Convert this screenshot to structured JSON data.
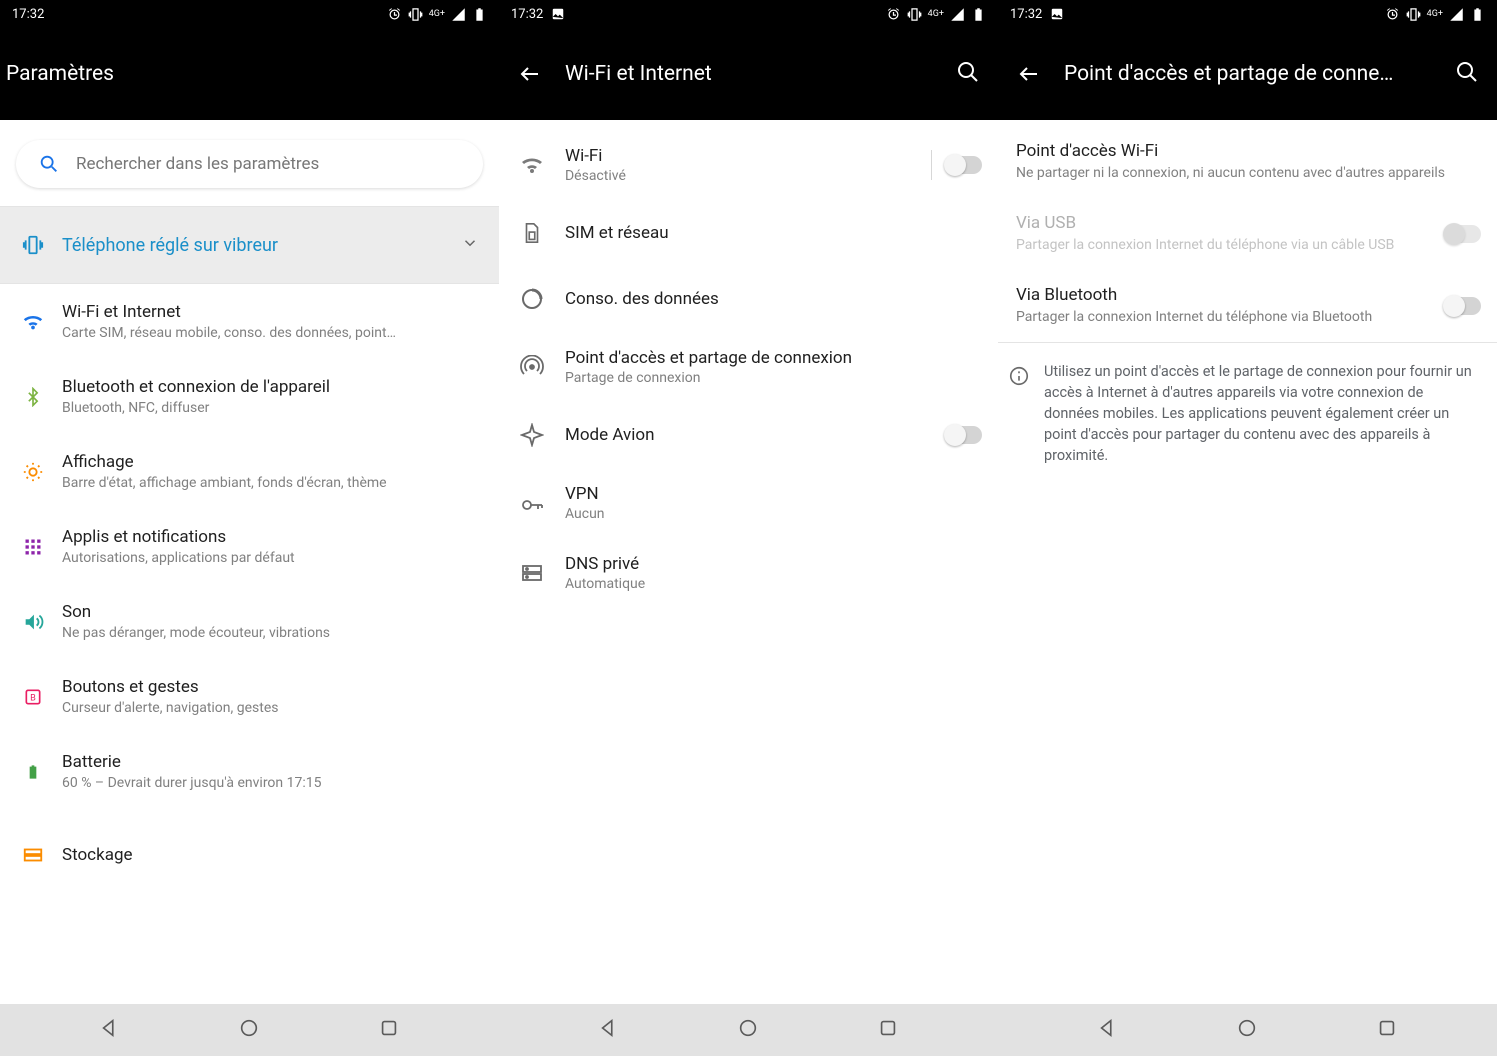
{
  "statusbar": {
    "time": "17:32"
  },
  "screen1": {
    "title": "Paramètres",
    "search_placeholder": "Rechercher dans les paramètres",
    "ringer_text": "Téléphone réglé sur vibreur",
    "items": [
      {
        "label": "Wi-Fi et Internet",
        "sub": "Carte SIM, réseau mobile, conso. des données, point…"
      },
      {
        "label": "Bluetooth et connexion de l'appareil",
        "sub": "Bluetooth, NFC, diffuser"
      },
      {
        "label": "Affichage",
        "sub": "Barre d'état, affichage ambiant, fonds d'écran, thème"
      },
      {
        "label": "Applis et notifications",
        "sub": "Autorisations, applications par défaut"
      },
      {
        "label": "Son",
        "sub": "Ne pas déranger, mode écouteur, vibrations"
      },
      {
        "label": "Boutons et gestes",
        "sub": "Curseur d'alerte, navigation, gestes"
      },
      {
        "label": "Batterie",
        "sub": "60 % – Devrait durer jusqu'à environ 17:15"
      },
      {
        "label": "Stockage",
        "sub": ""
      }
    ]
  },
  "screen2": {
    "title": "Wi-Fi et Internet",
    "items": [
      {
        "label": "Wi-Fi",
        "sub": "Désactivé"
      },
      {
        "label": "SIM et réseau",
        "sub": ""
      },
      {
        "label": "Conso. des données",
        "sub": ""
      },
      {
        "label": "Point d'accès et partage de connexion",
        "sub": "Partage de connexion"
      },
      {
        "label": "Mode Avion",
        "sub": ""
      },
      {
        "label": "VPN",
        "sub": "Aucun"
      },
      {
        "label": "DNS privé",
        "sub": "Automatique"
      }
    ]
  },
  "screen3": {
    "title": "Point d'accès et partage de conne…",
    "hotspot": {
      "label": "Point d'accès Wi-Fi",
      "sub": "Ne partager ni la connexion, ni aucun contenu avec d'autres appareils"
    },
    "usb": {
      "label": "Via USB",
      "sub": "Partager la connexion Internet du téléphone via un câble USB"
    },
    "bt": {
      "label": "Via Bluetooth",
      "sub": "Partager la connexion Internet du téléphone via Bluetooth"
    },
    "info": "Utilisez un point d'accès et le partage de connexion pour fournir un accès à Internet à d'autres appareils via votre connexion de données mobiles. Les applications peuvent également créer un point d'accès pour partager du contenu avec des appareils à proximité."
  }
}
